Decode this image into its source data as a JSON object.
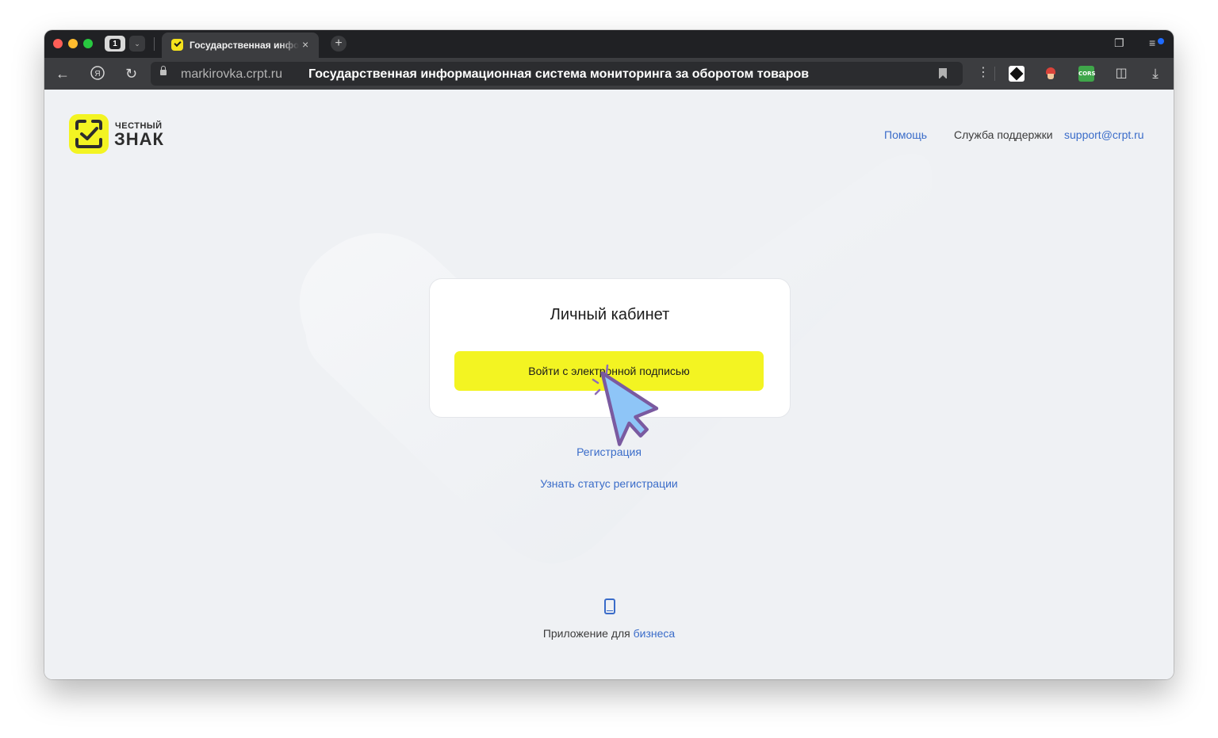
{
  "browser": {
    "tab_count": "1",
    "tab_title": "Государственная информационная система мониторинга за оборотом товаров",
    "tab_close": "×",
    "new_tab": "+",
    "url_domain": "markirovka.crpt.ru",
    "url_title": "Государственная информационная система мониторинга за оборотом товаров",
    "back": "←",
    "yandex": "Я",
    "reload": "↻",
    "menu_dots": "⋮",
    "ext_cors_label": "CORS",
    "download": "⤓"
  },
  "header": {
    "logo_small": "ЧЕСТНЫЙ",
    "logo_big": "ЗНАК",
    "help_link": "Помощь",
    "support_label": "Служба поддержки",
    "support_email": "support@crpt.ru"
  },
  "card": {
    "title": "Личный кабинет",
    "login_button": "Войти с электронной подписью"
  },
  "links": {
    "register": "Регистрация",
    "check_status": "Узнать статус регистрации"
  },
  "footer": {
    "app_prefix": "Приложение для",
    "app_link": "бизнеса"
  },
  "colors": {
    "brand_yellow": "#f3f422",
    "link_blue": "#3a6cc9",
    "cursor_fill": "#8ec5f7",
    "cursor_stroke": "#7a5aa0"
  }
}
